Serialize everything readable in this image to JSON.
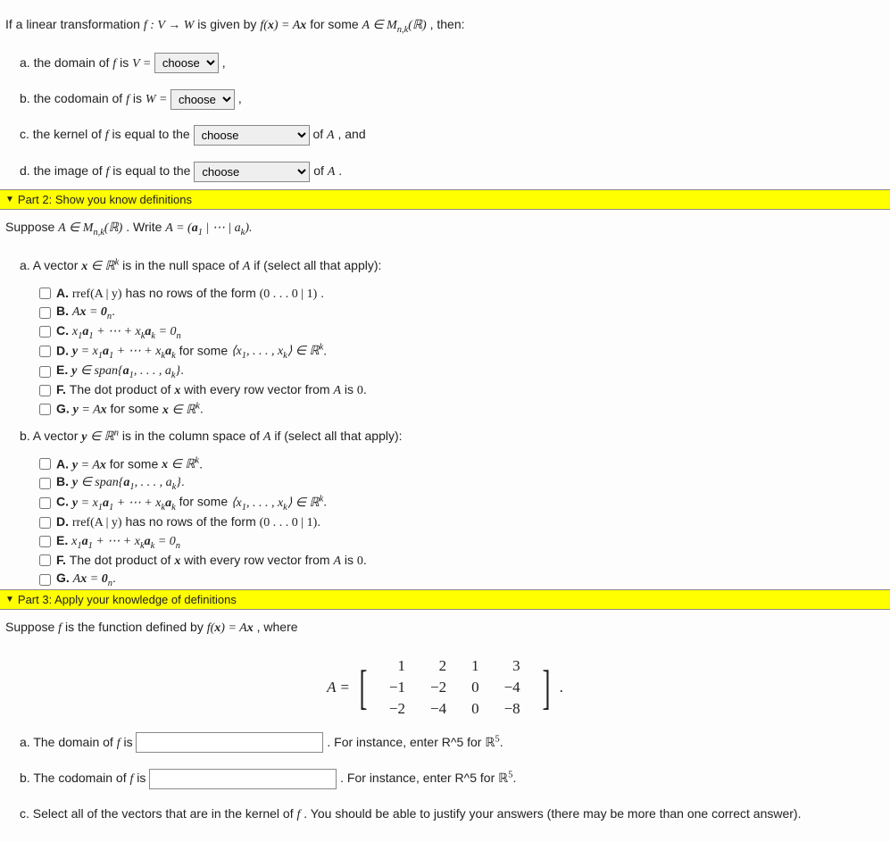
{
  "intro": {
    "prefix": "If a linear transformation ",
    "f_map": "f : V → W",
    "mid": " is given by ",
    "fx": "f(x) = Ax",
    "for_some": " for some ",
    "A_in": "A ∈ M",
    "nk": "n,k",
    "R": "(ℝ)",
    "suffix": ", then:"
  },
  "p1": {
    "a_pre": "a. the domain of ",
    "a_mid": " is ",
    "a_V": "V = ",
    "a_sel": "choose",
    "a_post": ",",
    "b_pre": "b. the codomain of ",
    "b_mid": " is ",
    "b_W": "W = ",
    "b_sel": "choose",
    "b_post": ",",
    "c_pre": "c. the kernel of ",
    "c_mid": " is equal to the ",
    "c_sel": "choose",
    "c_post1": " of ",
    "c_A": "A",
    "c_post2": ", and",
    "d_pre": "d. the image of ",
    "d_mid": " is equal to the ",
    "d_sel": "choose",
    "d_post1": " of ",
    "d_A": "A",
    "d_post2": "."
  },
  "sec2": {
    "title": "Part 2: Show you know definitions",
    "suppose_pre": "Suppose ",
    "A_in": "A ∈ M",
    "nk": "n,k",
    "R": "(ℝ)",
    "write": ". Write ",
    "Aeq": "A = (a",
    "sub1": "1",
    "mid": " | ⋯ | a",
    "subk": "k",
    "end": ").",
    "qa_pre": "a. A vector ",
    "qa_x": "x ∈ ℝ",
    "qa_k": "k",
    "qa_post": " is in the null space of ",
    "qa_A": "A",
    "qa_tail": " if (select all that apply):",
    "optA": {
      "lbl": "A. ",
      "t1": "rref(A | y)",
      "t2": " has no rows of the form ",
      "t3": "(0 . . . 0 | 1)",
      "t4": "."
    },
    "optB": {
      "lbl": "B. ",
      "t1": "Ax = 0",
      "sub": "n",
      "t2": "."
    },
    "optC": {
      "lbl": "C. ",
      "t1": "x",
      "s1": "1",
      "t2": "a",
      "s2": "1",
      "plus": " + ⋯ + ",
      "t3": "x",
      "s3": "k",
      "t4": "a",
      "s4": "k",
      "eq": " = 0",
      "sn": "n"
    },
    "optD": {
      "lbl": "D. ",
      "t1": "y = x",
      "s1": "1",
      "t2": "a",
      "s2": "1",
      "plus": " + ⋯ + ",
      "t3": "x",
      "s3": "k",
      "t4": "a",
      "s4": "k",
      "for": " for some ",
      "tup": "⟨x",
      "ts1": "1",
      "tc": ", . . . , x",
      "tsk": "k",
      "tr": "⟩ ∈ ℝ",
      "tk": "k",
      "dot": "."
    },
    "optE": {
      "lbl": "E. ",
      "t1": "y ∈ span{a",
      "s1": "1",
      "t2": ", . . . , a",
      "sk": "k",
      "t3": "}",
      "dot": "."
    },
    "optF": {
      "lbl": "F. ",
      "txt": "The dot product of ",
      "x": "x",
      "mid": " with every row vector from ",
      "A": "A",
      "tail": " is ",
      "zero": "0",
      "dot": "."
    },
    "optG": {
      "lbl": "G. ",
      "t1": "y = Ax",
      "for": " for some ",
      "x": "x ∈ ℝ",
      "k": "k",
      "dot": "."
    },
    "qb_pre": "b. A vector ",
    "qb_y": "y ∈ ℝ",
    "qb_n": "n",
    "qb_post": " is in the column space of ",
    "qb_A": "A",
    "qb_tail": " if (select all that apply):",
    "boptA": {
      "lbl": "A. ",
      "t1": "y = Ax",
      "for": " for some ",
      "x": "x ∈ ℝ",
      "k": "k",
      "dot": "."
    },
    "boptB": {
      "lbl": "B. ",
      "t1": "y ∈ span{a",
      "s1": "1",
      "t2": ", . . . , a",
      "sk": "k",
      "t3": "}",
      "dot": "."
    },
    "boptC": {
      "lbl": "C. ",
      "t1": "y = x",
      "s1": "1",
      "t2": "a",
      "s2": "1",
      "plus": " + ⋯ + ",
      "t3": "x",
      "s3": "k",
      "t4": "a",
      "s4": "k",
      "for": " for some ",
      "tup": "⟨x",
      "ts1": "1",
      "tc": ", . . . , x",
      "tsk": "k",
      "tr": "⟩ ∈ ℝ",
      "tk": "k",
      "dot": "."
    },
    "boptD": {
      "lbl": "D. ",
      "t1": "rref(A | y)",
      "t2": " has no rows of the form ",
      "t3": "(0 . . . 0 | 1)",
      "t4": "."
    },
    "boptE": {
      "lbl": "E. ",
      "t1": "x",
      "s1": "1",
      "t2": "a",
      "s2": "1",
      "plus": " + ⋯ + ",
      "t3": "x",
      "s3": "k",
      "t4": "a",
      "s4": "k",
      "eq": " = 0",
      "sn": "n"
    },
    "boptF": {
      "lbl": "F. ",
      "txt": "The dot product of ",
      "x": "x",
      "mid": " with every row vector from ",
      "A": "A",
      "tail": " is ",
      "zero": "0",
      "dot": "."
    },
    "boptG": {
      "lbl": "G. ",
      "t1": "Ax = 0",
      "sub": "n",
      "t2": "."
    }
  },
  "sec3": {
    "title": "Part 3: Apply your knowledge of definitions",
    "suppose_pre": "Suppose ",
    "f": "f",
    "mid1": " is the function defined by ",
    "fx": "f(x) = Ax",
    "tail": ", where",
    "Aeq": "A = ",
    "matrix": [
      [
        "1",
        "2",
        "1",
        "3"
      ],
      [
        "−1",
        "−2",
        "0",
        "−4"
      ],
      [
        "−2",
        "−4",
        "0",
        "−8"
      ]
    ],
    "dot": ".",
    "qa_pre": "a. The domain of ",
    "qa_post": " is ",
    "qa_hint_pre": ". For instance, enter R^5 for ",
    "qa_R5": "ℝ",
    "qa_5": "5",
    "qa_dot": ".",
    "qb_pre": "b. The codomain of ",
    "qb_post": " is ",
    "qb_hint_pre": ". For instance, enter R^5 for ",
    "qb_R5": "ℝ",
    "qb_5": "5",
    "qb_dot": ".",
    "qc": "c. Select all of the vectors that are in the kernel of ",
    "qc_tail": ". You should be able to justify your answers (there may be more than one correct answer)."
  },
  "f_letter": "f"
}
